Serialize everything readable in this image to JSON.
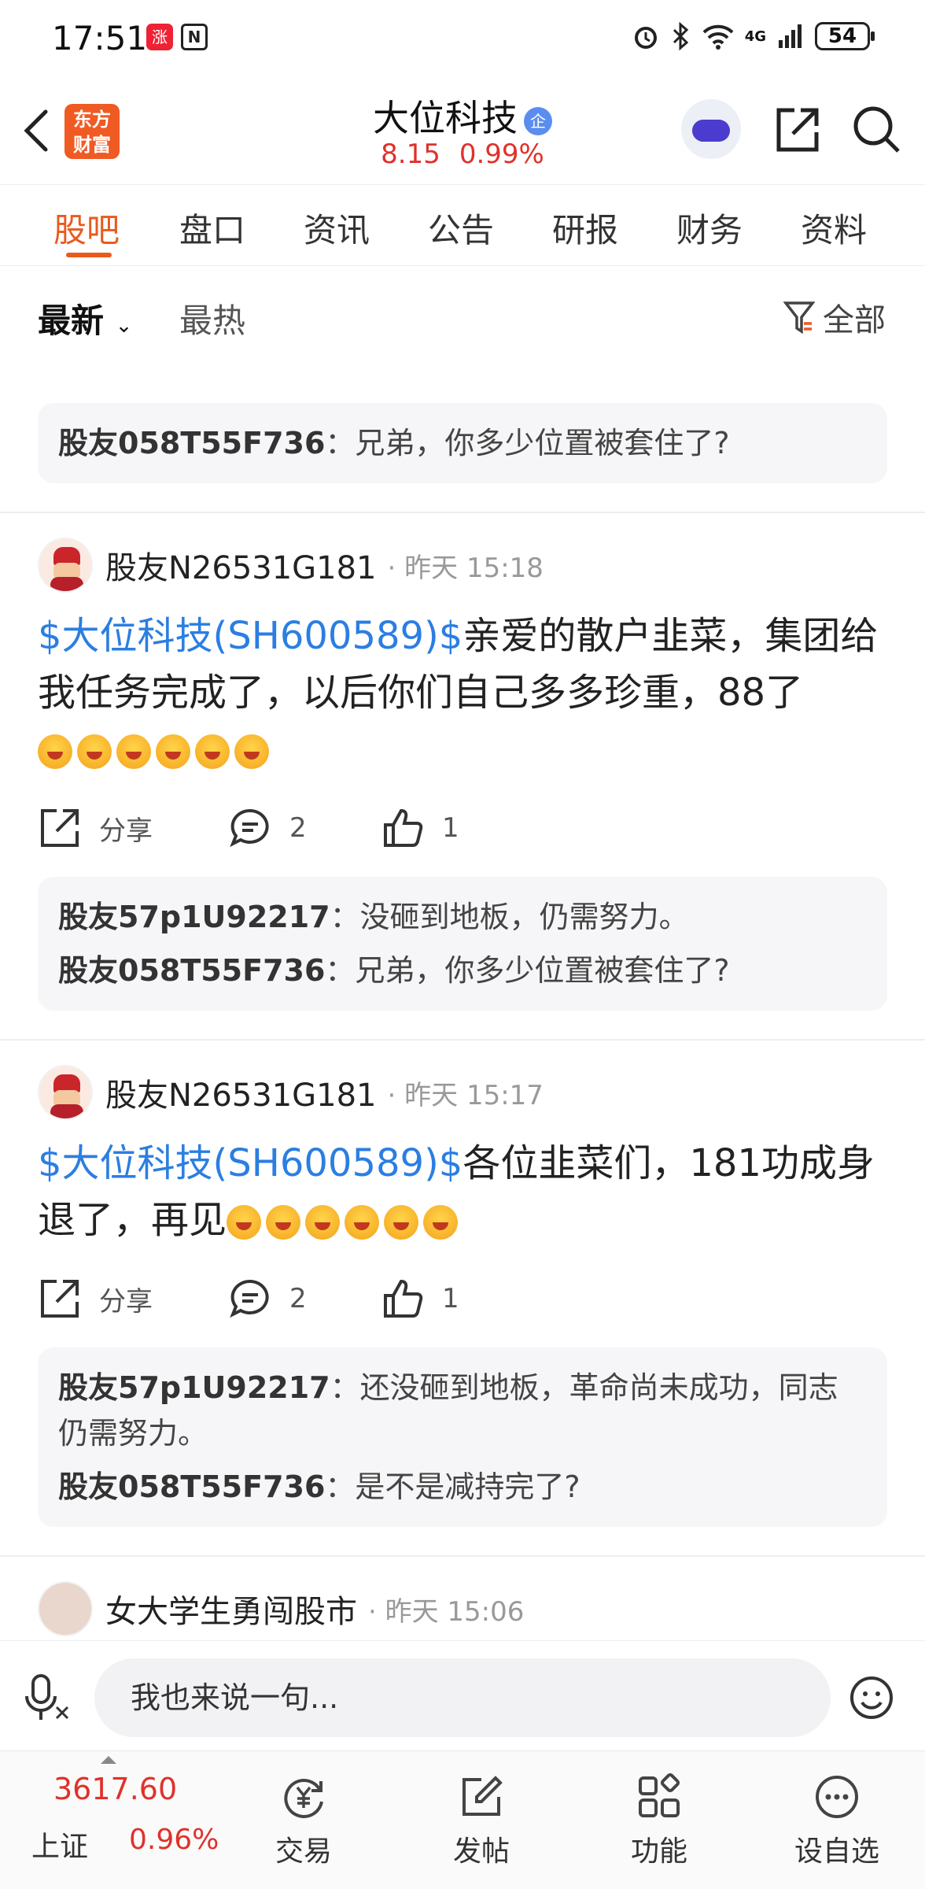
{
  "status": {
    "time": "17:51",
    "network": "4G",
    "battery": "54"
  },
  "header": {
    "title": "大位科技",
    "badge": "企",
    "price": "8.15",
    "change_pct": "0.99%",
    "logo_text_1": "东方",
    "logo_text_2": "财富"
  },
  "tabs": [
    "股吧",
    "盘口",
    "资讯",
    "公告",
    "研报",
    "财务",
    "资料"
  ],
  "filter": {
    "latest": "最新",
    "hot": "最热",
    "all": "全部"
  },
  "feed": {
    "top_reply": {
      "user": "股友058T55F736",
      "text": "：兄弟，你多少位置被套住了?"
    },
    "posts": [
      {
        "user": "股友N26531G181",
        "time": "· 昨天 15:18",
        "stock_tag": "$大位科技(SH600589)$",
        "text": "亲爱的散户韭菜，集团给我任务完成了，以后你们自己多多珍重，88了",
        "share": "分享",
        "comments": "2",
        "likes": "1",
        "replies": [
          {
            "user": "股友57p1U92217",
            "text": "：没砸到地板，仍需努力。"
          },
          {
            "user": "股友058T55F736",
            "text": "：兄弟，你多少位置被套住了?"
          }
        ]
      },
      {
        "user": "股友N26531G181",
        "time": "· 昨天 15:17",
        "stock_tag": "$大位科技(SH600589)$",
        "text": "各位韭菜们，181功成身退了，再见",
        "share": "分享",
        "comments": "2",
        "likes": "1",
        "replies": [
          {
            "user": "股友57p1U92217",
            "text": "：还没砸到地板，革命尚未成功，同志仍需努力。"
          },
          {
            "user": "股友058T55F736",
            "text": "：是不是减持完了?"
          }
        ]
      },
      {
        "user": "女大学生勇闯股市",
        "time": "· 昨天 15:06"
      }
    ]
  },
  "input": {
    "placeholder": "我也来说一句..."
  },
  "bottom_nav": {
    "index_value": "3617.60",
    "index_name": "上证",
    "index_pct": "0.96%",
    "items": [
      "交易",
      "发帖",
      "功能",
      "设自选"
    ]
  }
}
